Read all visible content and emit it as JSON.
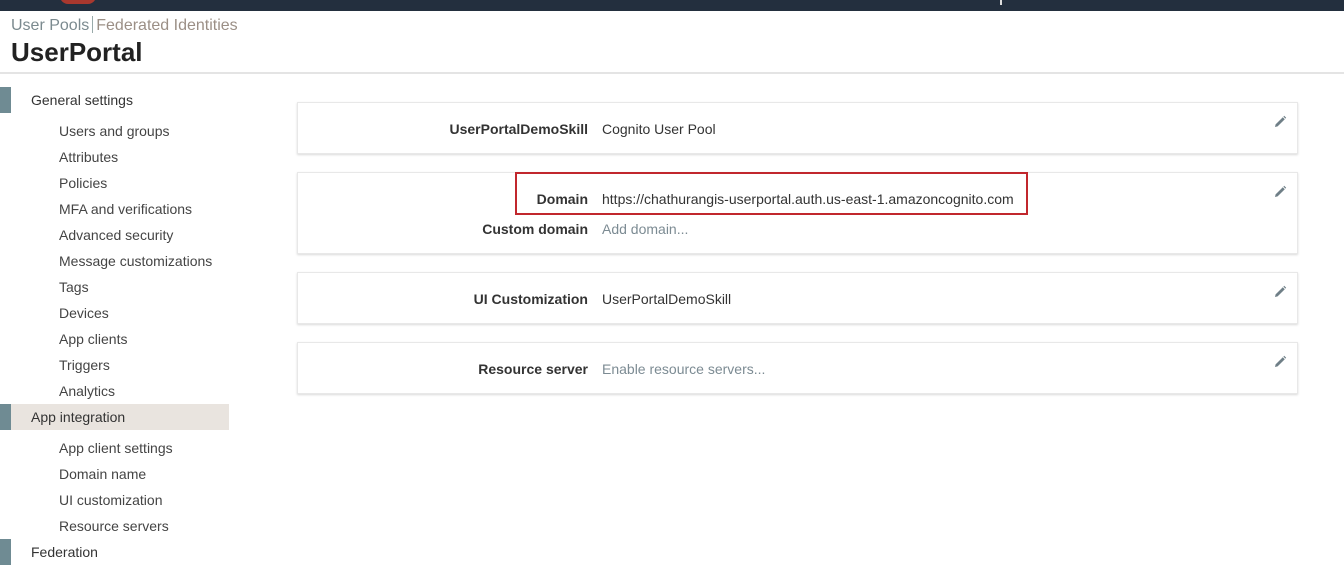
{
  "breadcrumb": {
    "user_pools": "User Pools",
    "federated": "Federated Identities"
  },
  "page_title": "UserPortal",
  "sidebar": {
    "general_settings": "General settings",
    "general_items": [
      "Users and groups",
      "Attributes",
      "Policies",
      "MFA and verifications",
      "Advanced security",
      "Message customizations",
      "Tags",
      "Devices",
      "App clients",
      "Triggers",
      "Analytics"
    ],
    "app_integration": "App integration",
    "app_items": [
      "App client settings",
      "Domain name",
      "UI customization",
      "Resource servers"
    ],
    "federation": "Federation"
  },
  "panels": {
    "p1": {
      "key": "UserPortalDemoSkill",
      "value": "Cognito User Pool"
    },
    "p2": {
      "domain_key": "Domain",
      "domain_value": "https://chathurangis-userportal.auth.us-east-1.amazoncognito.com",
      "custom_key": "Custom domain",
      "custom_value": "Add domain..."
    },
    "p3": {
      "key": "UI Customization",
      "value": "UserPortalDemoSkill"
    },
    "p4": {
      "key": "Resource server",
      "value": "Enable resource servers..."
    }
  },
  "colors": {
    "highlight": "#c1272d",
    "section_bar": "#6f8b93",
    "topbar": "#232f3e"
  },
  "icons": {
    "edit": "pencil-icon"
  }
}
